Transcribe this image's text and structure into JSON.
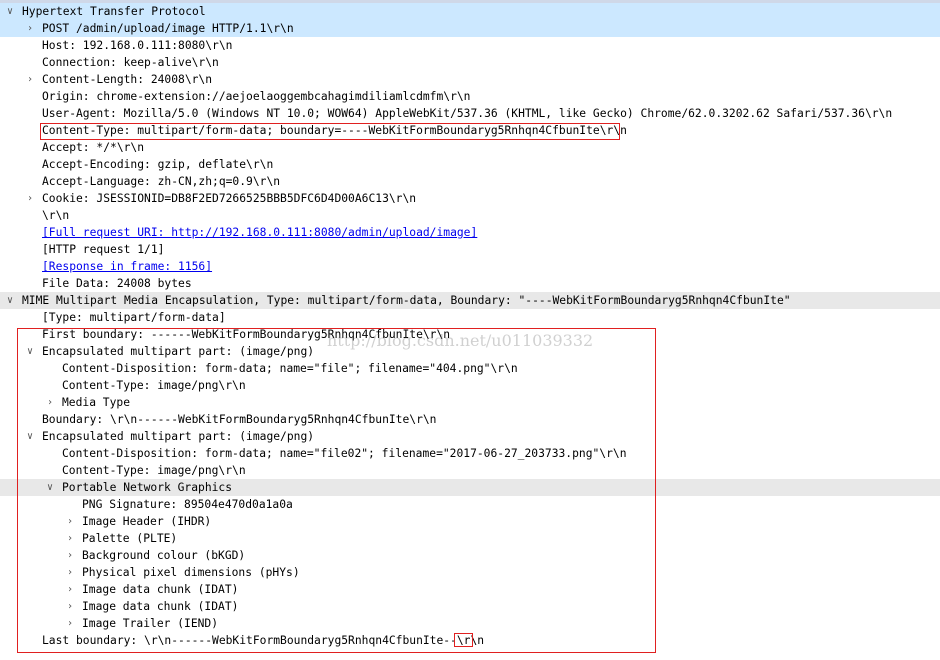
{
  "rows": [
    {
      "text": "Hypertext Transfer Protocol",
      "indent": 0,
      "toggle": "expanded",
      "style": "top"
    },
    {
      "text": "POST /admin/upload/image HTTP/1.1\\r\\n",
      "indent": 1,
      "toggle": "collapsed",
      "style": "sel"
    },
    {
      "text": "Host: 192.168.0.111:8080\\r\\n",
      "indent": 1
    },
    {
      "text": "Connection: keep-alive\\r\\n",
      "indent": 1
    },
    {
      "text": "Content-Length: 24008\\r\\n",
      "indent": 1,
      "toggle": "collapsed"
    },
    {
      "text": "Origin: chrome-extension://aejoelaoggembcahagimdiliamlcdmfm\\r\\n",
      "indent": 1
    },
    {
      "text": "User-Agent: Mozilla/5.0 (Windows NT 10.0; WOW64) AppleWebKit/537.36 (KHTML, like Gecko) Chrome/62.0.3202.62 Safari/537.36\\r\\n",
      "indent": 1
    },
    {
      "text": "Content-Type: multipart/form-data; boundary=----WebKitFormBoundaryg5Rnhqn4CfbunIte\\r\\n",
      "indent": 1
    },
    {
      "text": "Accept: */*\\r\\n",
      "indent": 1
    },
    {
      "text": "Accept-Encoding: gzip, deflate\\r\\n",
      "indent": 1
    },
    {
      "text": "Accept-Language: zh-CN,zh;q=0.9\\r\\n",
      "indent": 1
    },
    {
      "text": "Cookie: JSESSIONID=DB8F2ED7266525BBB5DFC6D4D00A6C13\\r\\n",
      "indent": 1,
      "toggle": "collapsed"
    },
    {
      "text": "\\r\\n",
      "indent": 1
    },
    {
      "text": "[Full request URI: http://192.168.0.111:8080/admin/upload/image]",
      "indent": 1,
      "link": true
    },
    {
      "text": "[HTTP request 1/1]",
      "indent": 1
    },
    {
      "text": "[Response in frame: 1156]",
      "indent": 1,
      "link": true
    },
    {
      "text": "File Data: 24008 bytes",
      "indent": 1
    },
    {
      "text": "MIME Multipart Media Encapsulation, Type: multipart/form-data, Boundary: \"----WebKitFormBoundaryg5Rnhqn4CfbunIte\"",
      "indent": 0,
      "toggle": "expanded",
      "style": "hl"
    },
    {
      "text": "[Type: multipart/form-data]",
      "indent": 1
    },
    {
      "text": "First boundary: ------WebKitFormBoundaryg5Rnhqn4CfbunIte\\r\\n",
      "indent": 1
    },
    {
      "text": "Encapsulated multipart part:  (image/png)",
      "indent": 1,
      "toggle": "expanded"
    },
    {
      "text": "Content-Disposition: form-data; name=\"file\"; filename=\"404.png\"\\r\\n",
      "indent": 2
    },
    {
      "text": "Content-Type: image/png\\r\\n",
      "indent": 2
    },
    {
      "text": "Media Type",
      "indent": 2,
      "toggle": "collapsed"
    },
    {
      "text": "Boundary: \\r\\n------WebKitFormBoundaryg5Rnhqn4CfbunIte\\r\\n",
      "indent": 1
    },
    {
      "text": "Encapsulated multipart part:  (image/png)",
      "indent": 1,
      "toggle": "expanded"
    },
    {
      "text": "Content-Disposition: form-data; name=\"file02\"; filename=\"2017-06-27_203733.png\"\\r\\n",
      "indent": 2
    },
    {
      "text": "Content-Type: image/png\\r\\n",
      "indent": 2
    },
    {
      "text": "Portable Network Graphics",
      "indent": 2,
      "toggle": "expanded",
      "style": "hl"
    },
    {
      "text": "PNG Signature: 89504e470d0a1a0a",
      "indent": 3
    },
    {
      "text": "Image Header (IHDR)",
      "indent": 3,
      "toggle": "collapsed"
    },
    {
      "text": "Palette (PLTE)",
      "indent": 3,
      "toggle": "collapsed"
    },
    {
      "text": "Background colour (bKGD)",
      "indent": 3,
      "toggle": "collapsed"
    },
    {
      "text": "Physical pixel dimensions (pHYs)",
      "indent": 3,
      "toggle": "collapsed"
    },
    {
      "text": "Image data chunk (IDAT)",
      "indent": 3,
      "toggle": "collapsed"
    },
    {
      "text": "Image data chunk (IDAT)",
      "indent": 3,
      "toggle": "collapsed"
    },
    {
      "text": "Image Trailer (IEND)",
      "indent": 3,
      "toggle": "collapsed"
    },
    {
      "text": "Last boundary: \\r\\n------WebKitFormBoundaryg5Rnhqn4CfbunIte--\\r\\n",
      "indent": 1
    }
  ],
  "icons": {
    "expanded": "chevron-down-icon",
    "collapsed": "chevron-right-icon"
  },
  "watermark": "http://blog.csdn.net/u011039332",
  "colors": {
    "selection": "#cce8ff",
    "highlight": "#e8e8e8",
    "link": "#0000ee",
    "annotation": "#e02020"
  }
}
